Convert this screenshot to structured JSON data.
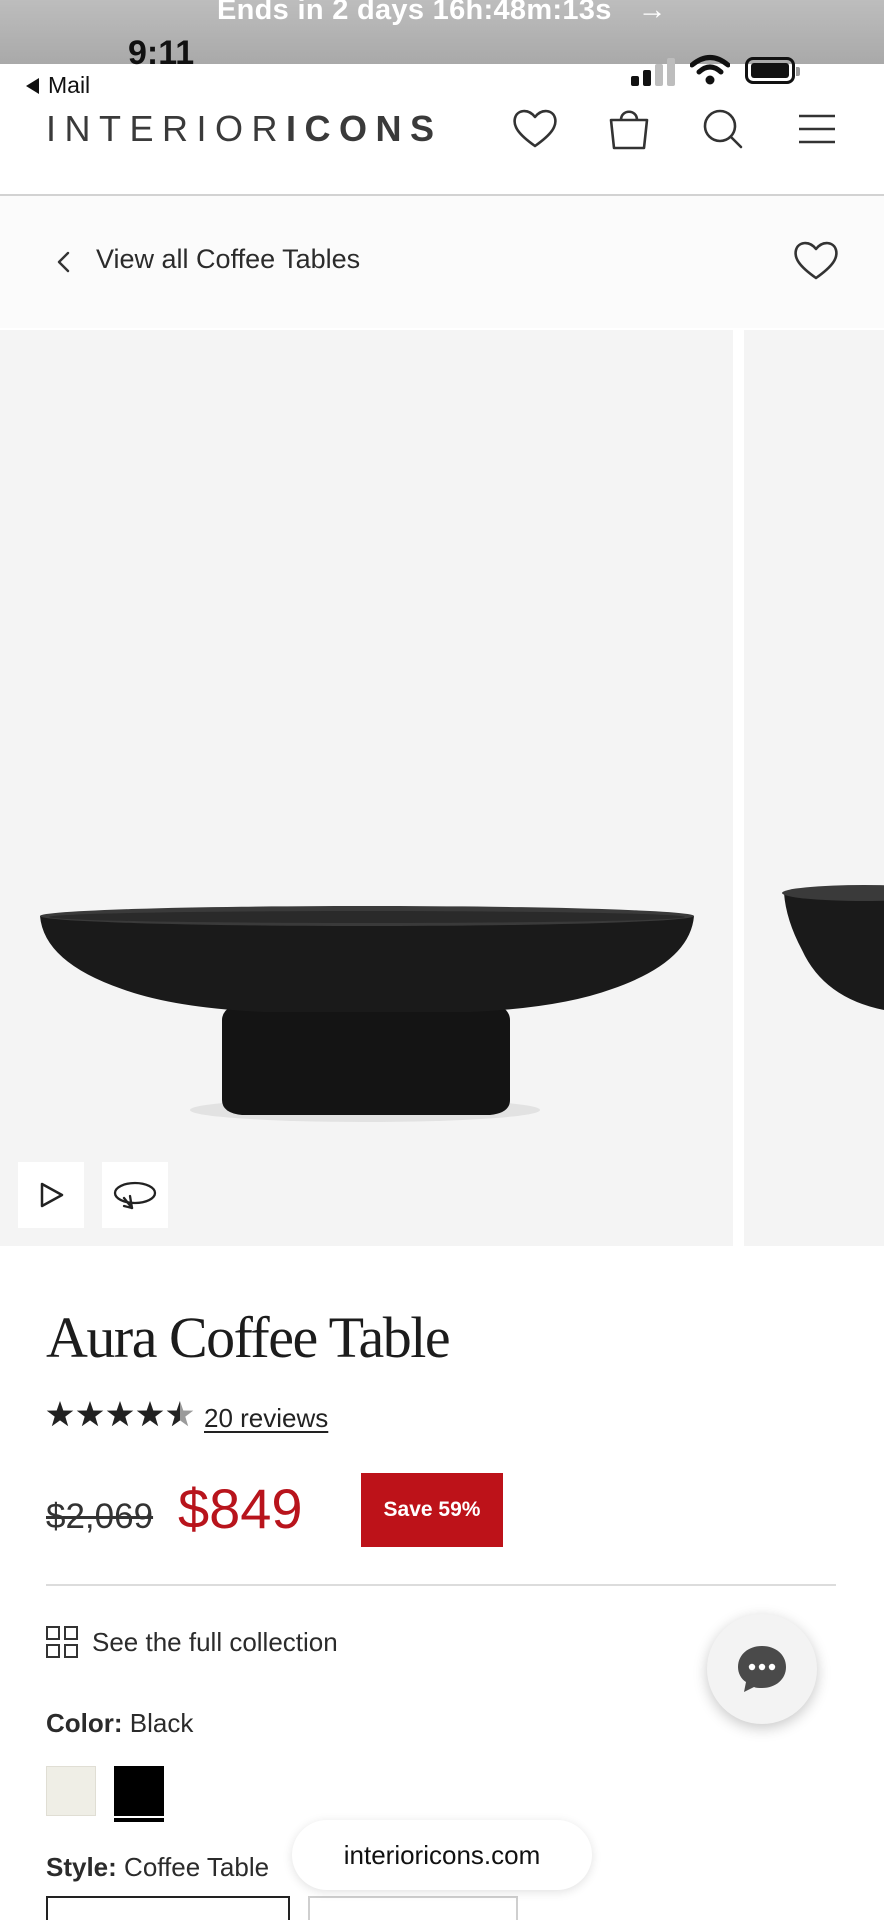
{
  "promo_banner": {
    "text": "Ends in 2 days 16h:48m:13s",
    "arrow": "→"
  },
  "status_bar": {
    "time": "9:11",
    "back_app": "Mail"
  },
  "header": {
    "logo_light": "INTERIOR",
    "logo_bold": "ICONS",
    "icons": [
      "heart-icon",
      "shopping-bag-icon",
      "search-icon",
      "menu-icon"
    ]
  },
  "breadcrumb": {
    "label": "View all Coffee Tables"
  },
  "gallery": {
    "controls": [
      "play-icon",
      "rotate-360-icon"
    ]
  },
  "product": {
    "title": "Aura Coffee Table",
    "rating": 4.5,
    "reviews_label": "20 reviews",
    "original_price": "$2,069",
    "sale_price": "$849",
    "save_badge": "Save 59%",
    "collection_link": "See the full collection",
    "color_label": "Color:",
    "color_value": "Black",
    "swatches": [
      {
        "name": "Ivory",
        "hex": "#efeee6"
      },
      {
        "name": "Black",
        "hex": "#000000",
        "selected": true
      }
    ],
    "style_label": "Style:",
    "style_value": "Coffee Table"
  },
  "colors": {
    "sale_red": "#bd1219",
    "price_red": "#b8141c",
    "background": "#f4f4f4"
  },
  "url_bar": {
    "domain": "interioricons.com"
  }
}
